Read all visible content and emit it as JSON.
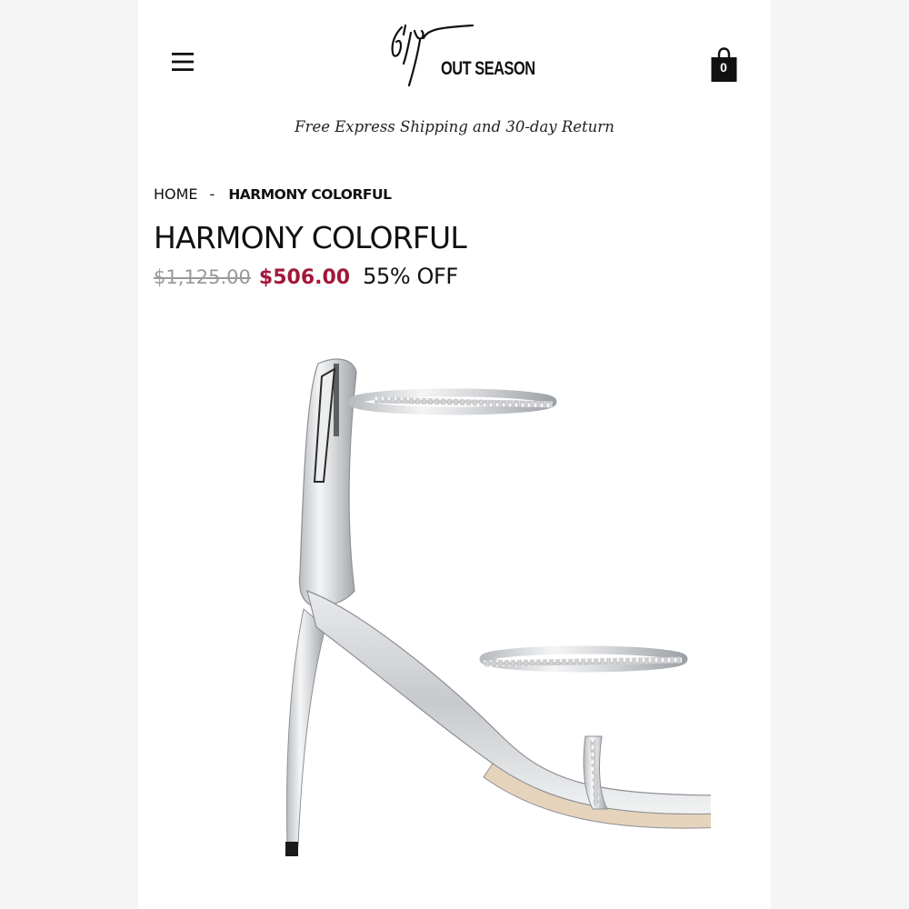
{
  "header": {
    "menu_icon": "hamburger-menu-icon",
    "logo_text": "OUT SEASON",
    "cart_icon": "shopping-bag-icon",
    "cart_count": "0"
  },
  "promo": {
    "text": "Free Express Shipping and 30-day Return"
  },
  "breadcrumb": {
    "home": "HOME",
    "separator": "-",
    "current": "HARMONY COLORFUL"
  },
  "product": {
    "title": "HARMONY COLORFUL",
    "original_price": "$1,125.00",
    "sale_price": "$506.00",
    "discount": "55% OFF"
  },
  "colors": {
    "sale_price": "#a3173a",
    "strikethrough_price": "#9a9a9a",
    "text": "#111111",
    "background": "#ffffff"
  }
}
